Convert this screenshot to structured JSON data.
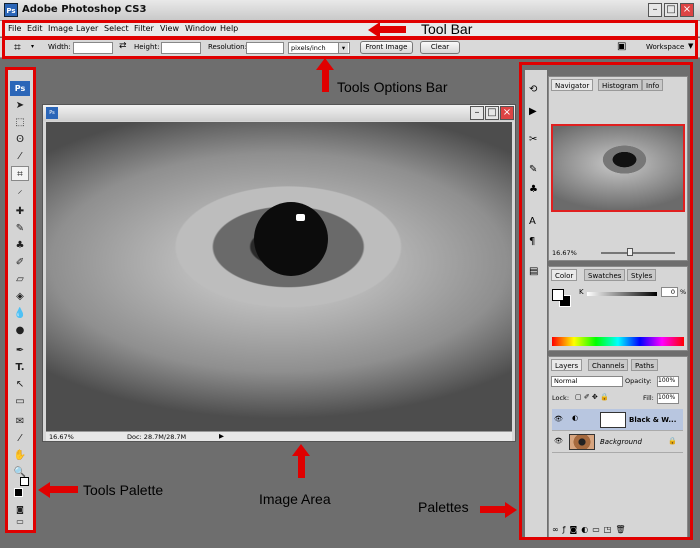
{
  "app": {
    "title": "Adobe Photoshop CS3",
    "logo_text": "Ps",
    "doc_icon_text": "Ps"
  },
  "menu": [
    "File",
    "Edit",
    "Image",
    "Layer",
    "Select",
    "Filter",
    "View",
    "Window",
    "Help"
  ],
  "options_bar": {
    "width_label": "Width:",
    "height_label": "Height:",
    "resolution_label": "Resolution:",
    "units_value": "pixels/inch",
    "front_image_label": "Front Image",
    "clear_label": "Clear",
    "workspace_label": "Workspace"
  },
  "document": {
    "zoom": "16.67%",
    "doc_info": "Doc: 28.7M/28.7M"
  },
  "navigator": {
    "tabs": [
      "Navigator",
      "Histogram",
      "Info"
    ],
    "zoom": "16.67%"
  },
  "color_panel": {
    "tabs": [
      "Color",
      "Swatches",
      "Styles"
    ],
    "channel_label": "K",
    "channel_value": "0",
    "unit": "%"
  },
  "layers_panel": {
    "tabs": [
      "Layers",
      "Channels",
      "Paths"
    ],
    "blend_mode": "Normal",
    "opacity_label": "Opacity:",
    "opacity_value": "100%",
    "lock_label": "Lock:",
    "fill_label": "Fill:",
    "fill_value": "100%",
    "layers": [
      {
        "name": "Black & W..."
      },
      {
        "name": "Background"
      }
    ]
  },
  "annotations": {
    "tool_bar": "Tool Bar",
    "tools_options_bar": "Tools Options Bar",
    "tools_palette": "Tools Palette",
    "image_area": "Image Area",
    "palettes": "Palettes"
  },
  "colors": {
    "annotation_red": "#e00000",
    "workspace_gray": "#6e6e6e"
  }
}
